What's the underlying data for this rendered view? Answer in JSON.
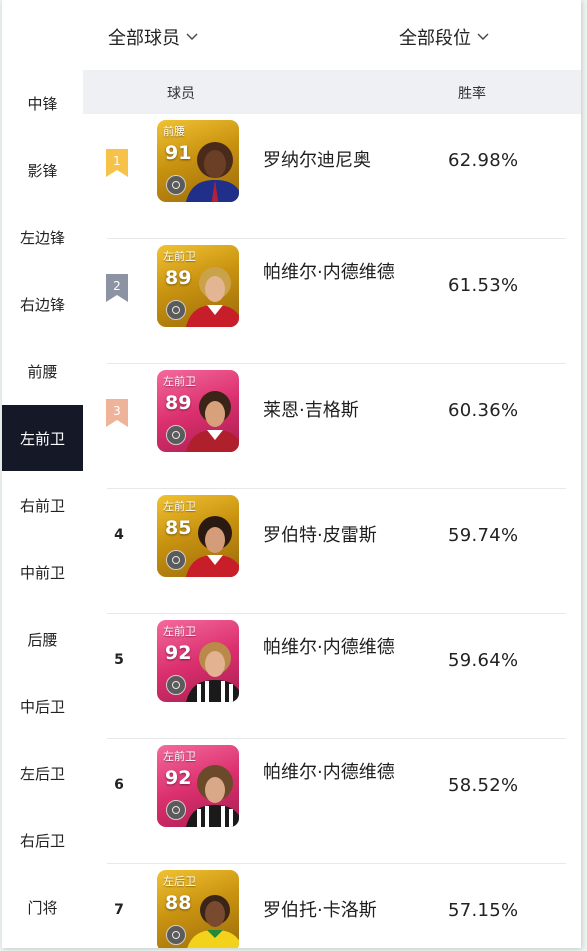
{
  "filters": {
    "players": "全部球员",
    "tiers": "全部段位"
  },
  "sidebar": {
    "items": [
      {
        "label": "中锋"
      },
      {
        "label": "影锋"
      },
      {
        "label": "左边锋"
      },
      {
        "label": "右边锋"
      },
      {
        "label": "前腰"
      },
      {
        "label": "左前卫",
        "active": true
      },
      {
        "label": "右前卫"
      },
      {
        "label": "中前卫"
      },
      {
        "label": "后腰"
      },
      {
        "label": "中后卫"
      },
      {
        "label": "左后卫"
      },
      {
        "label": "右后卫"
      },
      {
        "label": "门将"
      }
    ]
  },
  "table": {
    "header": {
      "player": "球员",
      "winrate": "胜率"
    },
    "rows": [
      {
        "rank": "1",
        "rank_style": "gold-flag",
        "position": "前腰",
        "rating": "91",
        "card_color": "gold",
        "name": "罗纳尔迪尼奥",
        "winrate": "62.98%"
      },
      {
        "rank": "2",
        "rank_style": "silver-flag",
        "position": "左前卫",
        "rating": "89",
        "card_color": "gold",
        "name": "帕维尔·内德维德",
        "winrate": "61.53%"
      },
      {
        "rank": "3",
        "rank_style": "bronze-flag",
        "position": "左前卫",
        "rating": "89",
        "card_color": "pink",
        "name": "莱恩·吉格斯",
        "winrate": "60.36%"
      },
      {
        "rank": "4",
        "rank_style": "plain",
        "position": "左前卫",
        "rating": "85",
        "card_color": "gold",
        "name": "罗伯特·皮雷斯",
        "winrate": "59.74%"
      },
      {
        "rank": "5",
        "rank_style": "plain",
        "position": "左前卫",
        "rating": "92",
        "card_color": "pink",
        "name": "帕维尔·内德维德",
        "winrate": "59.64%"
      },
      {
        "rank": "6",
        "rank_style": "plain",
        "position": "左前卫",
        "rating": "92",
        "card_color": "pink",
        "name": "帕维尔·内德维德",
        "winrate": "58.52%"
      },
      {
        "rank": "7",
        "rank_style": "plain",
        "position": "左后卫",
        "rating": "88",
        "card_color": "gold",
        "name": "罗伯托·卡洛斯",
        "winrate": "57.15%"
      }
    ]
  },
  "colors": {
    "active_sidebar": "#151827",
    "gold_flag": "#f7c24a",
    "silver_flag": "#8c93a3",
    "bronze_flag": "#efb39a",
    "gold_card": "#c99310",
    "pink_card": "#db2f6e"
  }
}
